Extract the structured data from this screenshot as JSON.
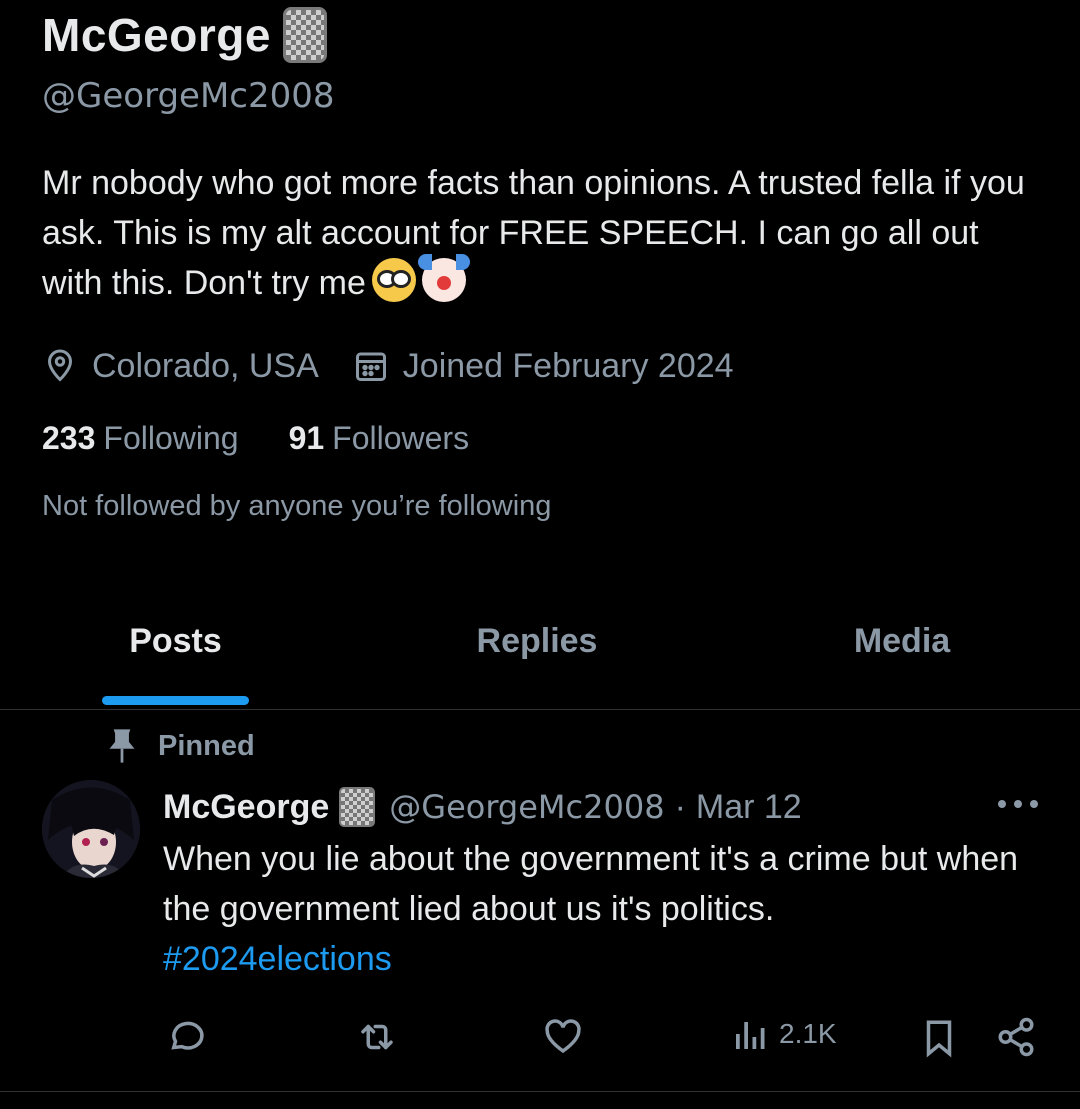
{
  "profile": {
    "display_name": "McGeorge",
    "handle": "@GeorgeMc2008",
    "bio": "Mr nobody who got more facts than opinions. A trusted fella if you ask. This is my alt account for FREE SPEECH. I can go all out with this. Don't try me",
    "location": "Colorado, USA",
    "joined": "Joined February 2024",
    "following_count": "233",
    "following_label": "Following",
    "followers_count": "91",
    "followers_label": "Followers",
    "not_followed": "Not followed by anyone you’re following"
  },
  "tabs": [
    {
      "label": "Posts",
      "active": true
    },
    {
      "label": "Replies",
      "active": false
    },
    {
      "label": "Media",
      "active": false
    }
  ],
  "post": {
    "pinned_label": "Pinned",
    "author_name": "McGeorge",
    "author_handle": "@GeorgeMc2008",
    "separator": "·",
    "date": "Mar 12",
    "text": "When you lie about the government it's a crime but when the government lied about us it's politics.",
    "hashtag": "#2024elections",
    "views": "2.1K"
  },
  "colors": {
    "background": "#000000",
    "text_primary": "#e7e9ea",
    "text_secondary": "#8b98a5",
    "accent": "#1d9bf0"
  }
}
